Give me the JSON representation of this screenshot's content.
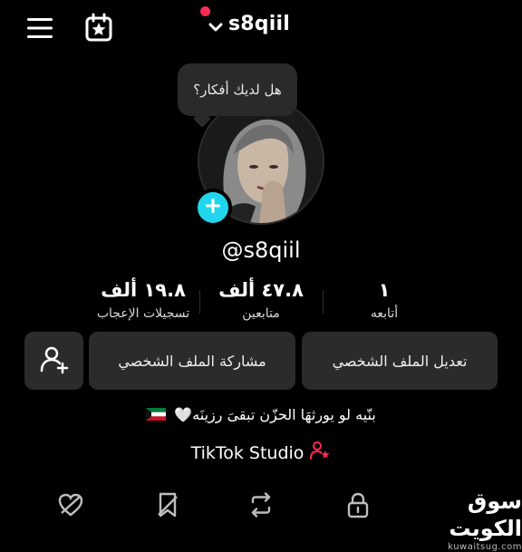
{
  "header": {
    "username": "s8qiil",
    "menu_icon": "hamburger-menu-icon",
    "calendar_icon": "calendar-star-icon",
    "chevron_icon": "chevron-down-icon"
  },
  "profile": {
    "thought_bubble": "هل لديك أفكار؟",
    "handle": "@s8qiil",
    "bio": "بنّيه لو يورثهَا الحزّن تبقىَ رزينَه🤍",
    "studio_label": "TikTok Studio"
  },
  "stats": [
    {
      "value": "١٩.٨ ألف",
      "label": "تسجيلات الإعجاب"
    },
    {
      "value": "٤٧.٨ ألف",
      "label": "متابعين"
    },
    {
      "value": "١",
      "label": "أتابعه"
    }
  ],
  "buttons": {
    "edit_profile": "تعديل الملف الشخصي",
    "share_profile": "مشاركة الملف الشخصي"
  },
  "bottom_tabs": [
    "liked-heart-icon",
    "favorites-icon",
    "repost-icon",
    "lock-icon"
  ],
  "watermark": {
    "arabic": "سوق الكويت",
    "url": "kuwaitsug.com"
  },
  "colors": {
    "background": "#000000",
    "button_bg": "#2b2b2b",
    "add_badge": "#20d5ec",
    "notification": "#fe2c55"
  }
}
